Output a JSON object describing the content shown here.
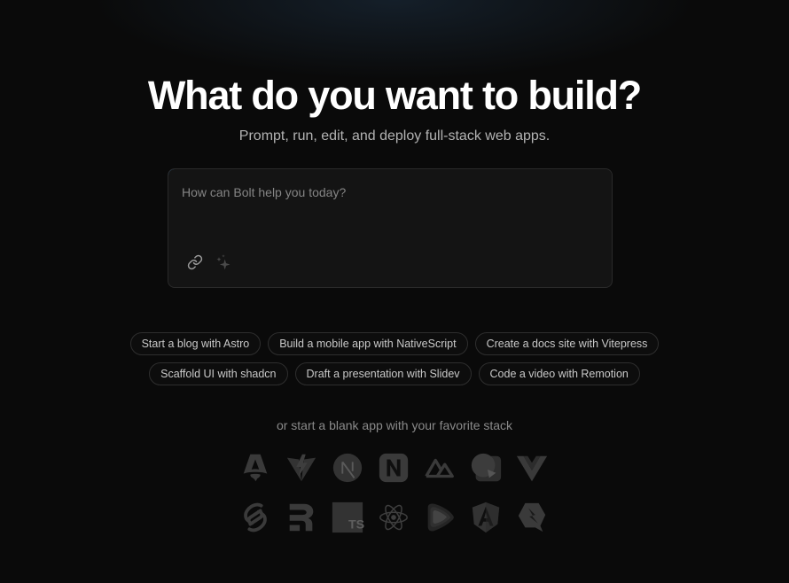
{
  "hero": {
    "title": "What do you want to build?",
    "subtitle": "Prompt, run, edit, and deploy full-stack web apps."
  },
  "prompt": {
    "placeholder": "How can Bolt help you today?",
    "value": "",
    "tools": [
      {
        "icon": "link-icon",
        "label": "Attach"
      },
      {
        "icon": "sparkles-icon",
        "label": "Enhance prompt"
      }
    ]
  },
  "suggestions": {
    "row1": [
      "Start a blog with Astro",
      "Build a mobile app with NativeScript",
      "Create a docs site with Vitepress"
    ],
    "row2": [
      "Scaffold UI with shadcn",
      "Draft a presentation with Slidev",
      "Code a video with Remotion"
    ]
  },
  "stacks": {
    "label": "or start a blank app with your favorite stack",
    "items": [
      {
        "name": "Astro",
        "icon": "astro-icon"
      },
      {
        "name": "Vite",
        "icon": "vite-icon"
      },
      {
        "name": "Next.js",
        "icon": "nextjs-icon"
      },
      {
        "name": "NativeScript",
        "icon": "nativescript-icon"
      },
      {
        "name": "Nuxt",
        "icon": "nuxt-icon"
      },
      {
        "name": "Gatsby/Slidev",
        "icon": "slidev-icon"
      },
      {
        "name": "Vue",
        "icon": "vue-icon"
      },
      {
        "name": "Svelte",
        "icon": "svelte-icon"
      },
      {
        "name": "Remix",
        "icon": "remix-icon"
      },
      {
        "name": "TypeScript",
        "icon": "typescript-icon"
      },
      {
        "name": "React",
        "icon": "react-icon"
      },
      {
        "name": "Remotion",
        "icon": "remotion-icon"
      },
      {
        "name": "Angular",
        "icon": "angular-icon"
      },
      {
        "name": "Qwik",
        "icon": "qwik-icon"
      }
    ]
  },
  "colors": {
    "background": "#0a0a0a",
    "accent": "#2f7fc4",
    "icon": "#3a3a3a"
  }
}
